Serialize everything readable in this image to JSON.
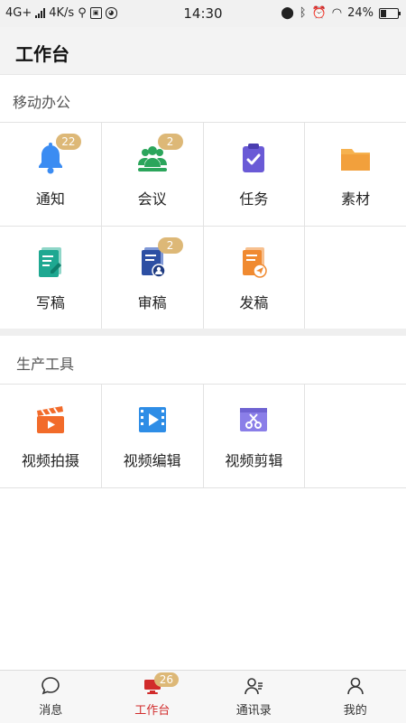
{
  "status_bar": {
    "network_left": "4G+",
    "speed": "4K/s",
    "time": "14:30",
    "battery": "24%",
    "icons": [
      "signal-icon",
      "usb-icon",
      "sim-icon",
      "notification-icon",
      "location-icon",
      "bluetooth-icon",
      "alarm-icon",
      "wifi-icon",
      "battery-icon"
    ]
  },
  "header": {
    "title": "工作台"
  },
  "sections": [
    {
      "title": "移动办公",
      "items": [
        {
          "label": "通知",
          "badge": "22",
          "icon": "bell-icon",
          "color": "#3b8cf2"
        },
        {
          "label": "会议",
          "badge": "2",
          "icon": "meeting-icon",
          "color": "#2ba55b"
        },
        {
          "label": "任务",
          "badge": "",
          "icon": "task-clipboard-icon",
          "color": "#6a5ad6"
        },
        {
          "label": "素材",
          "badge": "",
          "icon": "folder-icon",
          "color": "#f2a03c"
        },
        {
          "label": "写稿",
          "badge": "",
          "icon": "write-document-icon",
          "color": "#1ea891"
        },
        {
          "label": "审稿",
          "badge": "2",
          "icon": "review-document-icon",
          "color": "#2d4fa3"
        },
        {
          "label": "发稿",
          "badge": "",
          "icon": "publish-document-icon",
          "color": "#f08a30"
        }
      ]
    },
    {
      "title": "生产工具",
      "items": [
        {
          "label": "视频拍摄",
          "badge": "",
          "icon": "video-clapper-icon",
          "color": "#f26b2a"
        },
        {
          "label": "视频编辑",
          "badge": "",
          "icon": "video-edit-icon",
          "color": "#2e8de6"
        },
        {
          "label": "视频剪辑",
          "badge": "",
          "icon": "video-cut-icon",
          "color": "#8a7ee8"
        }
      ]
    }
  ],
  "tabs": [
    {
      "label": "消息",
      "badge": "",
      "icon": "message-icon",
      "active": false
    },
    {
      "label": "工作台",
      "badge": "26",
      "icon": "workbench-icon",
      "active": true
    },
    {
      "label": "通讯录",
      "badge": "",
      "icon": "contacts-icon",
      "active": false
    },
    {
      "label": "我的",
      "badge": "",
      "icon": "profile-icon",
      "active": false
    }
  ],
  "colors": {
    "accent": "#d12b2b",
    "badge": "#ddb877"
  }
}
